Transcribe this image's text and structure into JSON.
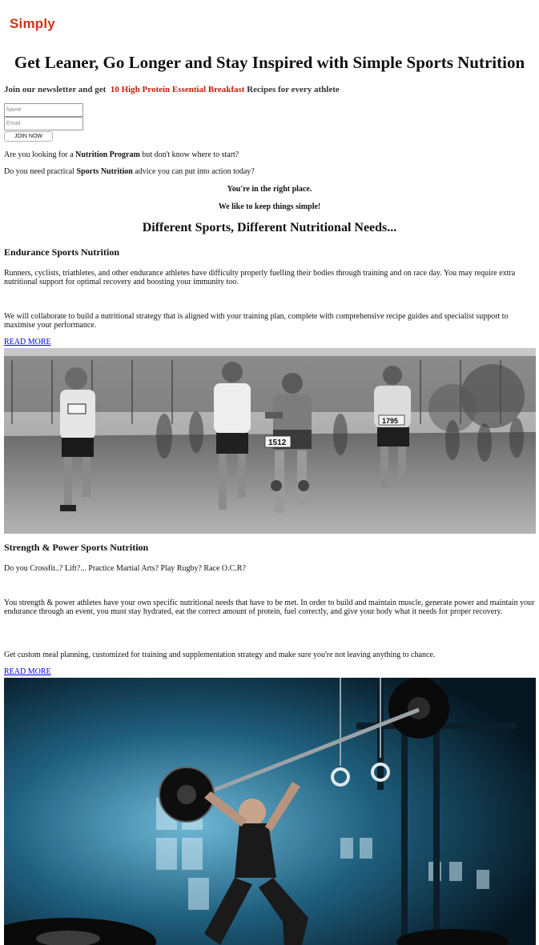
{
  "brand": {
    "logo_text": "Simply",
    "accent_color": "#cf3317"
  },
  "hero": {
    "headline": "Get Leaner, Go Longer and Stay Inspired with Simple Sports Nutrition"
  },
  "newsletter": {
    "intro": "Join our newsletter and get",
    "highlight": "10 High Protein Essential Breakfast",
    "outro": "Recipes for every athlete",
    "name_placeholder": "Name",
    "email_placeholder": "Email",
    "button_label": "JOIN NOW"
  },
  "intro": {
    "q1_before": "Are you looking for a ",
    "q1_bold": "Nutrition Program",
    "q1_after": " but don't know where to start?",
    "q2_before": "Do you need practical ",
    "q2_bold": "Sports Nutrition",
    "q2_after": " advice you can put into action today?",
    "line3": "You're in the right place.",
    "line4": "We like to keep things simple!"
  },
  "section_heading": "Different Sports, Different Nutritional Needs...",
  "endurance": {
    "title": "Endurance Sports Nutrition",
    "para1": "Runners, cyclists, triathletes, and other endurance athletes have difficulty properly fuelling their bodies through training and on race day. You may require extra nutritional support for optimal recovery and boosting your immunity too.",
    "para2": "We will collaborate to build a nutritional strategy that is aligned with your training plan, complete with comprehensive recipe guides and specialist support to maximise your performance.",
    "link": "READ MORE",
    "bibs": [
      "1512",
      "1795"
    ]
  },
  "strength": {
    "title": "Strength & Power Sports Nutrition",
    "para1": "Do you Crossfit..? Lift?... Practice Martial Arts? Play Rugby? Race O.C.R?",
    "para2": "You strength & power athletes have your own specific nutritional needs that have to be met. In order to build and maintain muscle, generate power and maintain your endurance through an event, you must stay hydrated, eat the correct amount of protein, fuel correctly, and give your body what it needs for proper recovery.",
    "para3": "Get custom meal planning, customized for training and supplementation strategy and make sure you're not leaving anything to chance.",
    "link": "READ MORE"
  }
}
